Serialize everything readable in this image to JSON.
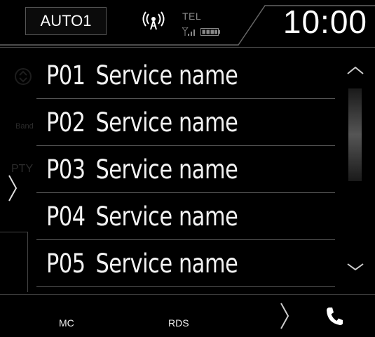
{
  "header": {
    "source_label": "AUTO1",
    "tel_label": "TEL",
    "clock": "10:00",
    "broadcast_icon": "broadcast-icon",
    "signal_icon": "signal-icon",
    "battery_icon": "battery-icon"
  },
  "presets": [
    {
      "number": "P01",
      "name": "Service name"
    },
    {
      "number": "P02",
      "name": "Service name"
    },
    {
      "number": "P03",
      "name": "Service name"
    },
    {
      "number": "P04",
      "name": "Service name"
    },
    {
      "number": "P05",
      "name": "Service name"
    }
  ],
  "side": {
    "ghost_band": "Band",
    "ghost_pty": "PTY",
    "arrow_icon": "chevron-right-icon"
  },
  "footer": {
    "mc_label": "MC",
    "rds_label": "RDS",
    "next_icon": "chevron-right-icon",
    "phone_icon": "phone-icon"
  },
  "colors": {
    "background": "#000000",
    "text": "#ffffff",
    "divider": "#5a5a5a",
    "muted": "#888888"
  }
}
